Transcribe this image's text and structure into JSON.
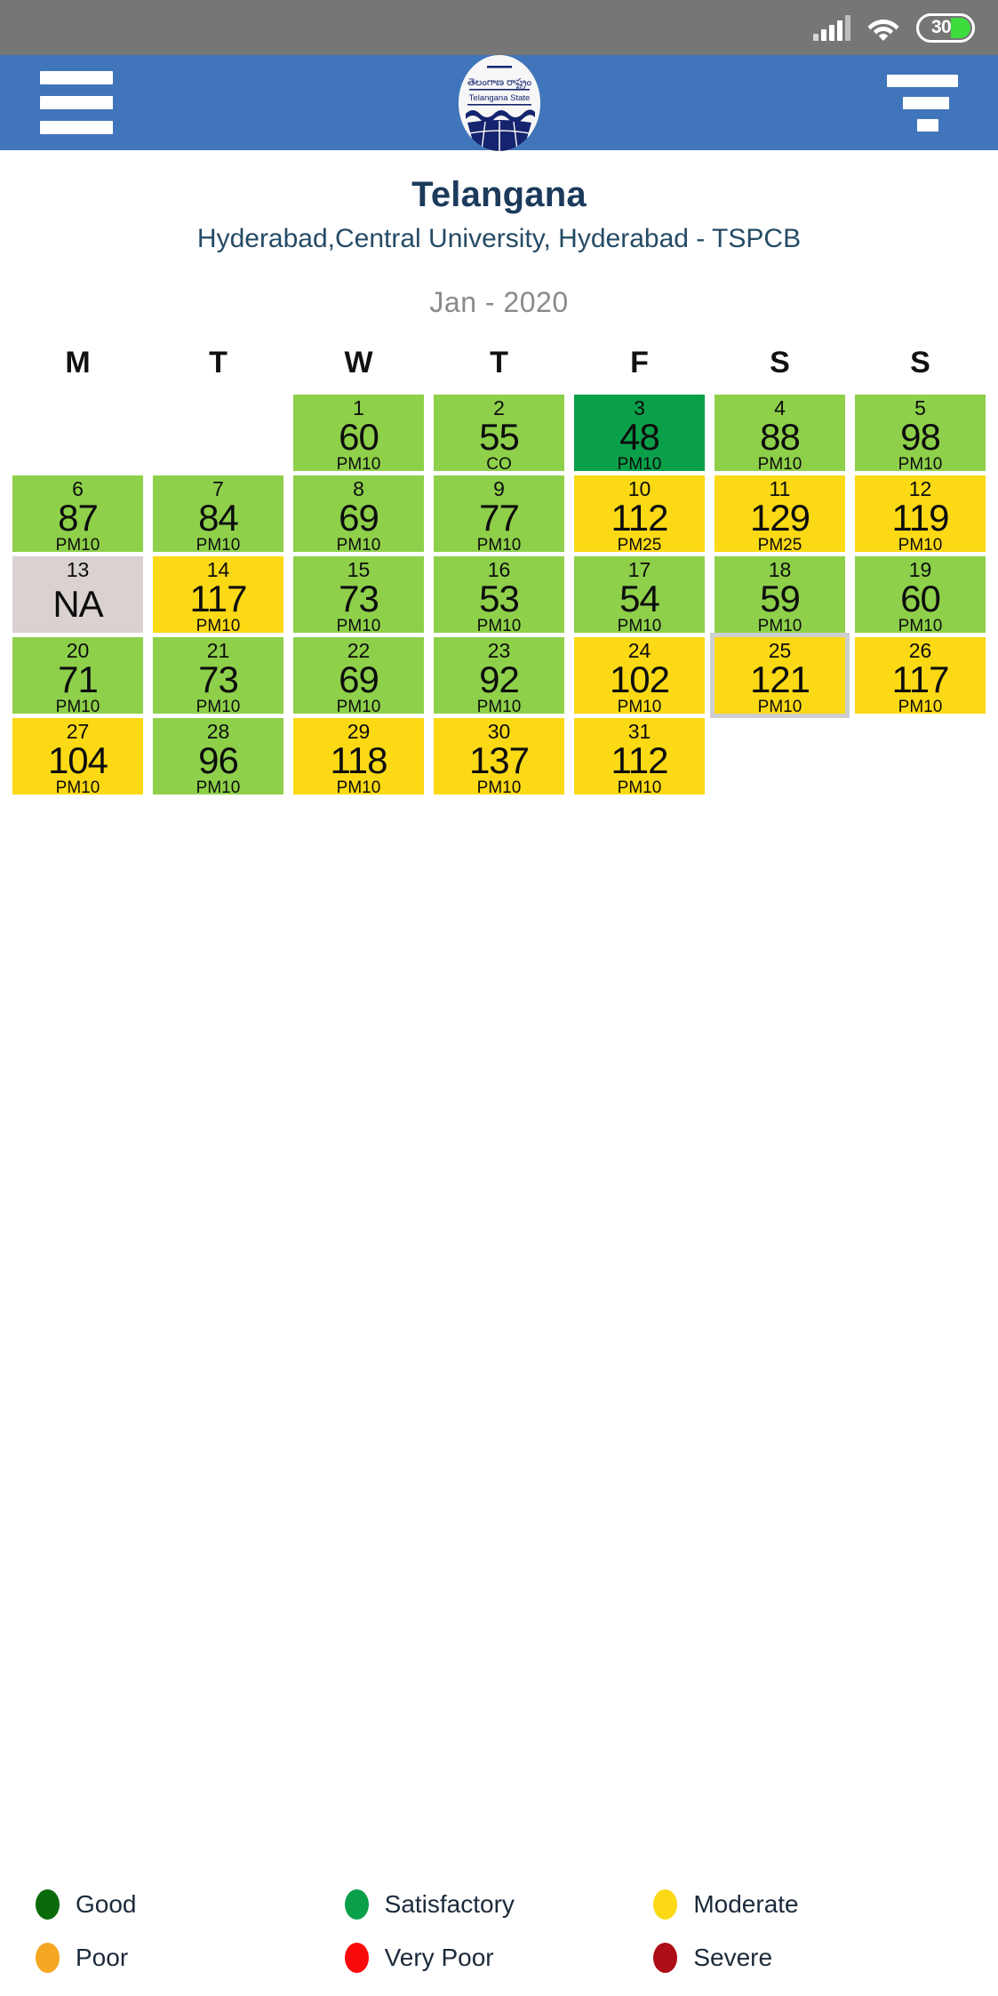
{
  "status_bar": {
    "signal_icon": "cellular-signal-icon",
    "wifi_icon": "wifi-icon",
    "battery_level": "30"
  },
  "app_bar": {
    "menu_icon": "hamburger-menu-icon",
    "filter_icon": "filter-icon",
    "logo": {
      "name": "telangana-state-emblem",
      "script_text": "తెలంగాణ రాష్ట్రం",
      "latin_text": "Telangana State"
    }
  },
  "header": {
    "state": "Telangana",
    "station": "Hyderabad,Central University, Hyderabad - TSPCB",
    "month": "Jan - 2020"
  },
  "calendar": {
    "weekday_headers": [
      "M",
      "T",
      "W",
      "T",
      "F",
      "S",
      "S"
    ],
    "weeks": [
      [
        {
          "day": "",
          "value": "",
          "pollutant": "",
          "category": "empty"
        },
        {
          "day": "",
          "value": "",
          "pollutant": "",
          "category": "empty"
        },
        {
          "day": "1",
          "value": "60",
          "pollutant": "PM10",
          "category": "moderate-green"
        },
        {
          "day": "2",
          "value": "55",
          "pollutant": "CO",
          "category": "moderate-green"
        },
        {
          "day": "3",
          "value": "48",
          "pollutant": "PM10",
          "category": "satisfactory"
        },
        {
          "day": "4",
          "value": "88",
          "pollutant": "PM10",
          "category": "moderate-green"
        },
        {
          "day": "5",
          "value": "98",
          "pollutant": "PM10",
          "category": "moderate-green"
        }
      ],
      [
        {
          "day": "6",
          "value": "87",
          "pollutant": "PM10",
          "category": "moderate-green"
        },
        {
          "day": "7",
          "value": "84",
          "pollutant": "PM10",
          "category": "moderate-green"
        },
        {
          "day": "8",
          "value": "69",
          "pollutant": "PM10",
          "category": "moderate-green"
        },
        {
          "day": "9",
          "value": "77",
          "pollutant": "PM10",
          "category": "moderate-green"
        },
        {
          "day": "10",
          "value": "112",
          "pollutant": "PM25",
          "category": "moderate"
        },
        {
          "day": "11",
          "value": "129",
          "pollutant": "PM25",
          "category": "moderate"
        },
        {
          "day": "12",
          "value": "119",
          "pollutant": "PM10",
          "category": "moderate"
        }
      ],
      [
        {
          "day": "13",
          "value": "NA",
          "pollutant": "",
          "category": "na"
        },
        {
          "day": "14",
          "value": "117",
          "pollutant": "PM10",
          "category": "moderate"
        },
        {
          "day": "15",
          "value": "73",
          "pollutant": "PM10",
          "category": "moderate-green"
        },
        {
          "day": "16",
          "value": "53",
          "pollutant": "PM10",
          "category": "moderate-green"
        },
        {
          "day": "17",
          "value": "54",
          "pollutant": "PM10",
          "category": "moderate-green"
        },
        {
          "day": "18",
          "value": "59",
          "pollutant": "PM10",
          "category": "moderate-green"
        },
        {
          "day": "19",
          "value": "60",
          "pollutant": "PM10",
          "category": "moderate-green"
        }
      ],
      [
        {
          "day": "20",
          "value": "71",
          "pollutant": "PM10",
          "category": "moderate-green"
        },
        {
          "day": "21",
          "value": "73",
          "pollutant": "PM10",
          "category": "moderate-green"
        },
        {
          "day": "22",
          "value": "69",
          "pollutant": "PM10",
          "category": "moderate-green"
        },
        {
          "day": "23",
          "value": "92",
          "pollutant": "PM10",
          "category": "moderate-green"
        },
        {
          "day": "24",
          "value": "102",
          "pollutant": "PM10",
          "category": "moderate"
        },
        {
          "day": "25",
          "value": "121",
          "pollutant": "PM10",
          "category": "moderate",
          "selected": true
        },
        {
          "day": "26",
          "value": "117",
          "pollutant": "PM10",
          "category": "moderate"
        }
      ],
      [
        {
          "day": "27",
          "value": "104",
          "pollutant": "PM10",
          "category": "moderate"
        },
        {
          "day": "28",
          "value": "96",
          "pollutant": "PM10",
          "category": "moderate-green"
        },
        {
          "day": "29",
          "value": "118",
          "pollutant": "PM10",
          "category": "moderate"
        },
        {
          "day": "30",
          "value": "137",
          "pollutant": "PM10",
          "category": "moderate"
        },
        {
          "day": "31",
          "value": "112",
          "pollutant": "PM10",
          "category": "moderate"
        },
        {
          "day": "",
          "value": "",
          "pollutant": "",
          "category": "empty"
        },
        {
          "day": "",
          "value": "",
          "pollutant": "",
          "category": "empty"
        }
      ]
    ]
  },
  "legend": [
    {
      "label": "Good",
      "color": "#0b6b0b"
    },
    {
      "label": "Satisfactory",
      "color": "#0aa04a"
    },
    {
      "label": "Moderate",
      "color": "#fbd914"
    },
    {
      "label": "Poor",
      "color": "#f5a623"
    },
    {
      "label": "Very Poor",
      "color": "#fa0a0a"
    },
    {
      "label": "Severe",
      "color": "#ad0d17"
    }
  ],
  "category_colors": {
    "good": "#0b6b0b",
    "satisfactory": "#0aa04a",
    "moderate-green": "#8ed04a",
    "moderate": "#fbd914",
    "poor": "#f5a623",
    "very-poor": "#fa0a0a",
    "severe": "#ad0d17",
    "na": "#d9d2d0",
    "empty": "transparent"
  },
  "theme": {
    "app_bar": "#4175bb",
    "status_bar": "#767676",
    "title_color": "#1b3a5c"
  }
}
